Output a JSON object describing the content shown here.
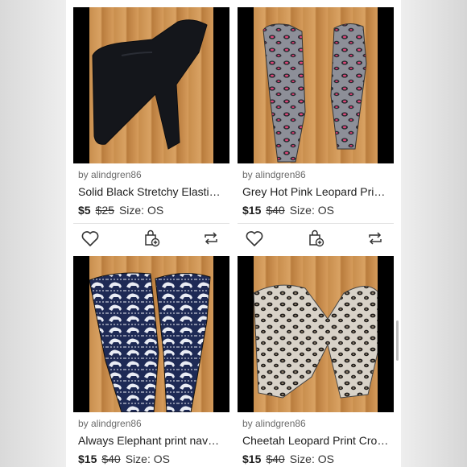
{
  "listings": [
    {
      "seller": "by alindgren86",
      "title": "Solid Black Stretchy Elastic Waist Leggings",
      "price": "$5",
      "original_price": "$25",
      "size": "Size: OS",
      "image_icon": "black-leggings-photo"
    },
    {
      "seller": "by alindgren86",
      "title": "Grey Hot Pink Leopard Print Leggings",
      "price": "$15",
      "original_price": "$40",
      "size": "Size: OS",
      "image_icon": "grey-pink-leopard-leggings-photo"
    },
    {
      "seller": "by alindgren86",
      "title": "Always Elephant print navy leggings",
      "price": "$15",
      "original_price": "$40",
      "size": "Size: OS",
      "image_icon": "elephant-print-leggings-photo"
    },
    {
      "seller": "by alindgren86",
      "title": "Cheetah Leopard Print Cropped Leggings",
      "price": "$15",
      "original_price": "$40",
      "size": "Size: OS",
      "image_icon": "cheetah-leggings-photo"
    }
  ],
  "actions": {
    "like_icon": "heart-icon",
    "bundle_icon": "shopping-bag-plus-icon",
    "share_icon": "share-repost-icon"
  },
  "colors": {
    "text": "#1f1f1f",
    "muted": "#6b6b6b",
    "floor": "#c98f4e"
  }
}
